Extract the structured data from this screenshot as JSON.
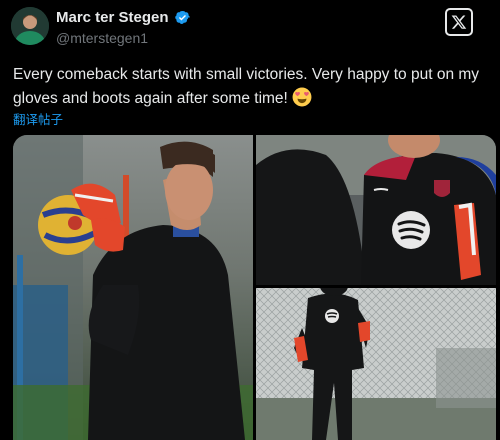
{
  "author": {
    "name": "Marc ter Stegen",
    "handle": "@mterstegen1",
    "verified": true,
    "avatar_icon": "goalkeeper-avatar"
  },
  "tweet": {
    "text": "Every comeback starts with small victories. Very happy to put on my gloves and boots again after some time!",
    "emoji": "smiling-face-with-heart-eyes",
    "translate_label": "翻译帖子"
  },
  "media": {
    "photos": [
      {
        "icon": "goalkeeper-holding-ball-photo"
      },
      {
        "icon": "smiling-player-spotify-shirt-photo"
      },
      {
        "icon": "goalkeeper-training-fence-photo"
      }
    ]
  },
  "colors": {
    "background": "#000000",
    "text": "#e7e9ea",
    "muted": "#71767b",
    "link": "#1d9bf0",
    "verified": "#1d9bf0"
  }
}
